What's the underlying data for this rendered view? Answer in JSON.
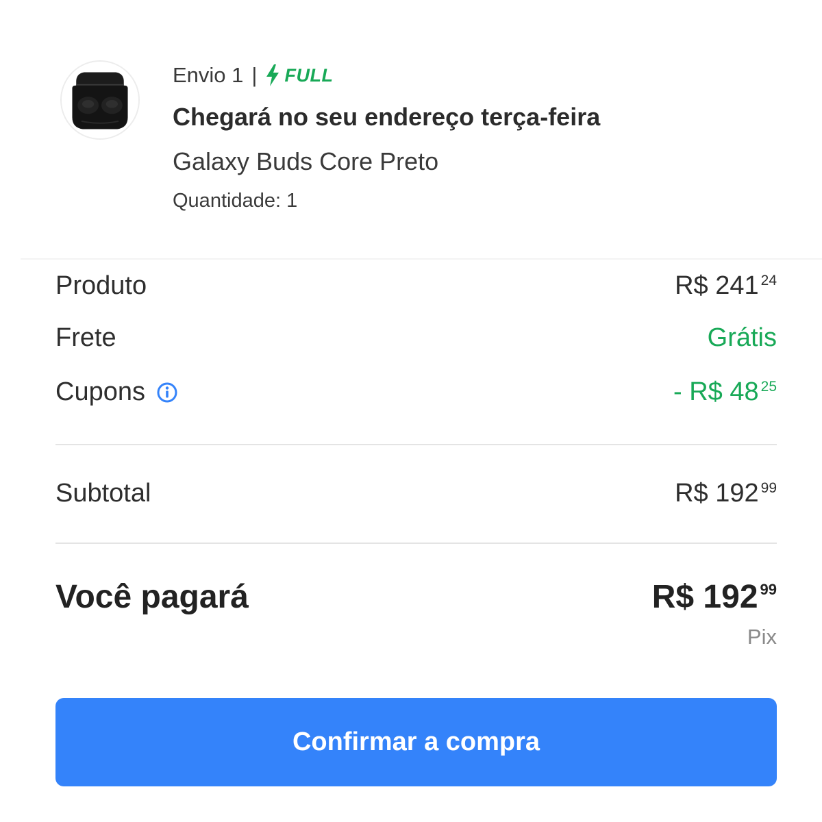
{
  "shipment": {
    "envio_label": "Envio 1",
    "separator": "|",
    "badge_label": "FULL",
    "arrival_text": "Chegará no seu endereço terça-feira",
    "product_name": "Galaxy Buds Core Preto",
    "quantity_text": "Quantidade: 1",
    "product_image": "black-earbuds-case"
  },
  "summary": {
    "produto": {
      "label": "Produto",
      "amount": "R$ 241",
      "cents": "24"
    },
    "frete": {
      "label": "Frete",
      "amount": "Grátis"
    },
    "cupons": {
      "label": "Cupons",
      "amount": "- R$ 48",
      "cents": "25",
      "icon": "info-icon"
    },
    "subtotal": {
      "label": "Subtotal",
      "amount": "R$ 192",
      "cents": "99"
    },
    "total": {
      "label": "Você pagará",
      "amount": "R$ 192",
      "cents": "99",
      "method": "Pix"
    }
  },
  "confirm_button": {
    "label": "Confirmar a compra"
  },
  "colors": {
    "accent_blue": "#3483fa",
    "success_green": "#18a957",
    "info_blue": "#3483fa",
    "text_dark": "#2e2e2e",
    "text_muted": "#8a8a8a"
  }
}
